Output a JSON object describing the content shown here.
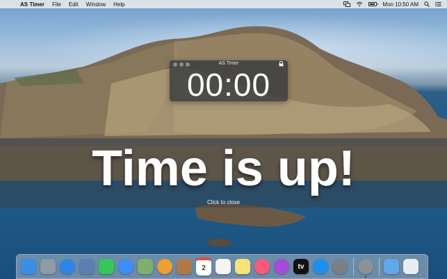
{
  "menubar": {
    "apple_icon": "apple-icon",
    "app_name": "AS Timer",
    "menus": [
      "File",
      "Edit",
      "Window",
      "Help"
    ],
    "clock": "Mon 10:50 AM",
    "status_icons": [
      "screen-mirroring-icon",
      "wifi-icon",
      "battery-icon",
      "spotlight-search-icon",
      "notification-center-icon"
    ]
  },
  "timer_window": {
    "title": "AS Timer",
    "display": "00:00",
    "favorite_icon": "heart-icon",
    "lock_icon": "lock-icon"
  },
  "overlay": {
    "message": "Time is up!",
    "hint": "Click to close"
  },
  "dock": {
    "apps": [
      {
        "name": "Finder",
        "icon": "finder-icon",
        "color": "#3a8ee6"
      },
      {
        "name": "Launchpad",
        "icon": "rocket-icon",
        "color": "#8e9aa8"
      },
      {
        "name": "Safari",
        "icon": "compass-icon",
        "color": "#2f86e8"
      },
      {
        "name": "Preview",
        "icon": "preview-icon",
        "color": "#5b7fae"
      },
      {
        "name": "FaceTime",
        "icon": "video-camera-icon",
        "color": "#34c759"
      },
      {
        "name": "Messages",
        "icon": "chat-bubble-icon",
        "color": "#3e8ef7"
      },
      {
        "name": "Maps",
        "icon": "map-icon",
        "color": "#7fb069"
      },
      {
        "name": "Photos",
        "icon": "flower-icon",
        "color": "#f0a030"
      },
      {
        "name": "Contacts",
        "icon": "contacts-book-icon",
        "color": "#b07a48"
      },
      {
        "name": "Calendar",
        "icon": "calendar-icon",
        "color": "#ffffff",
        "text": "2"
      },
      {
        "name": "Reminders",
        "icon": "checklist-icon",
        "color": "#f5f5f5"
      },
      {
        "name": "Notes",
        "icon": "notes-icon",
        "color": "#f7e27a"
      },
      {
        "name": "Music",
        "icon": "music-note-icon",
        "color": "#fa5a78"
      },
      {
        "name": "Podcasts",
        "icon": "podcast-icon",
        "color": "#a64bd9"
      },
      {
        "name": "TV",
        "icon": "apple-tv-icon",
        "color": "#111111",
        "text": "tv"
      },
      {
        "name": "App Store",
        "icon": "app-store-icon",
        "color": "#1f8ef1"
      },
      {
        "name": "System Preferences",
        "icon": "gear-icon",
        "color": "#7b7f86"
      },
      {
        "name": "AS Timer",
        "icon": "stopwatch-icon",
        "color": "#8d9299",
        "running": true
      },
      {
        "name": "Downloads",
        "icon": "folder-download-icon",
        "color": "#62a8e8"
      },
      {
        "name": "Trash",
        "icon": "trash-icon",
        "color": "#e8edf2"
      }
    ]
  }
}
